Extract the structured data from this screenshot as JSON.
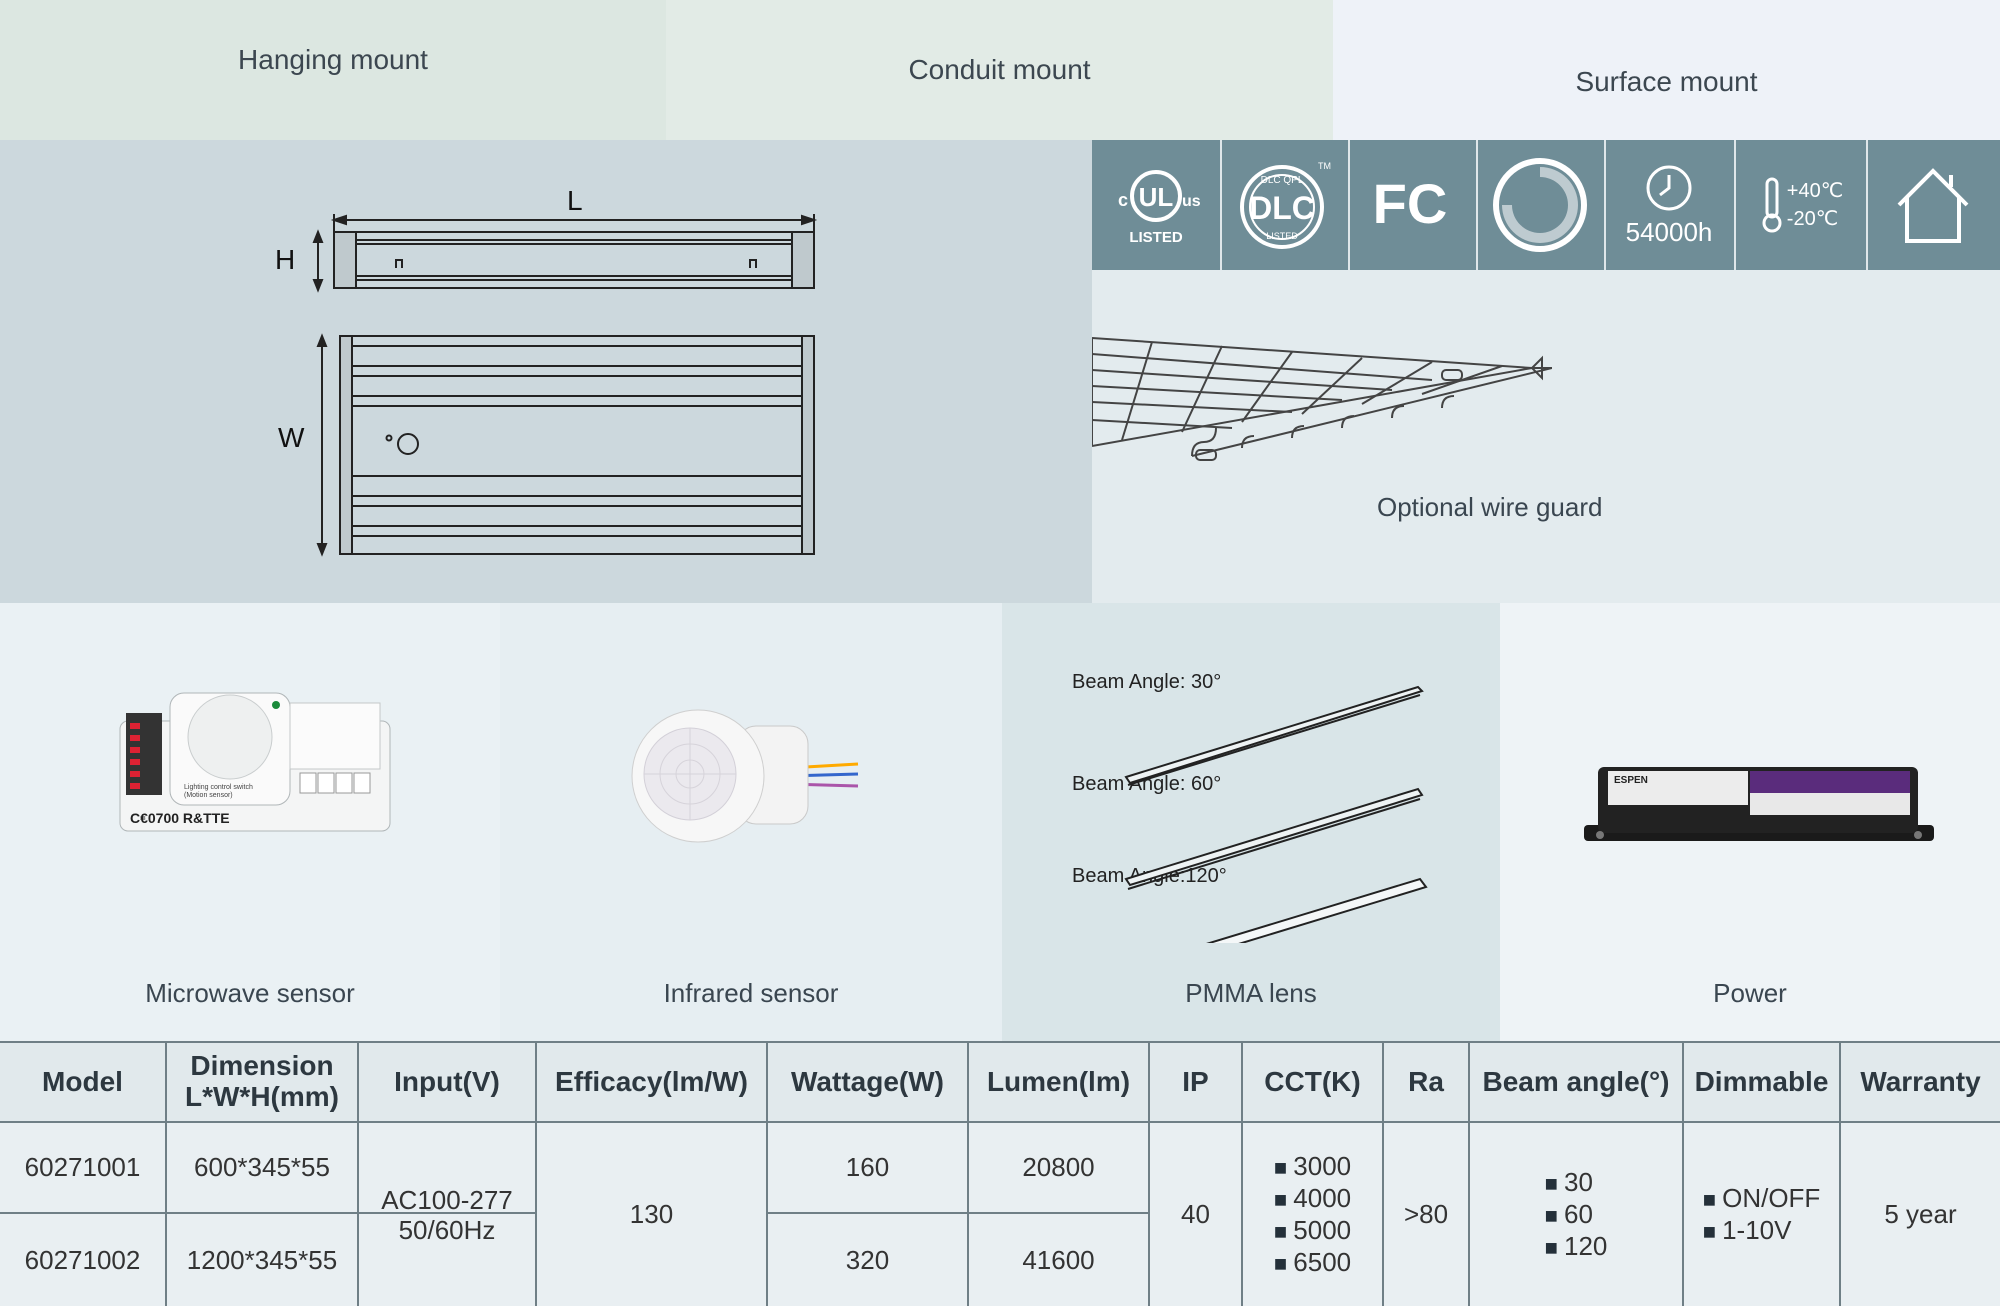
{
  "mounts": [
    "Hanging mount",
    "Conduit mount",
    "Surface mount"
  ],
  "dimensions": {
    "l": "L",
    "h": "H",
    "w": "W"
  },
  "certifications": {
    "ul": {
      "c": "c",
      "ul": "UL",
      "us": "us",
      "listed": "LISTED",
      "icon": "ul-listed-icon"
    },
    "dlc": {
      "top": "DLC QPL",
      "main": "DLC",
      "tm": "TM",
      "bottom": "LISTED",
      "icon": "dlc-qpl-icon"
    },
    "fcc": {
      "label": "FC",
      "icon": "fcc-icon"
    },
    "dimming": {
      "icon": "dimming-icon"
    },
    "lifetime": {
      "value": "54000h",
      "icon": "clock-icon"
    },
    "temperature": {
      "high": "+40℃",
      "low": "-20℃",
      "icon": "thermometer-icon"
    },
    "indoor": {
      "icon": "house-icon"
    }
  },
  "wire_guard": {
    "label": "Optional wire guard"
  },
  "accessories": [
    "Microwave sensor",
    "Infrared sensor",
    "PMMA lens",
    "Power"
  ],
  "microwave_sensor_print": {
    "line1": "Lighting control switch",
    "line2": "(Motion sensor)",
    "marks": "C€0700 R&TTE"
  },
  "power_print": {
    "brand": "ESPEN"
  },
  "beam_angles": [
    "Beam Angle: 30°",
    "Beam Angle: 60°",
    "Beam Angle:120°"
  ],
  "table": {
    "headers": {
      "model": "Model",
      "dimension1": "Dimension",
      "dimension2": "L*W*H(mm)",
      "input": "Input(V)",
      "efficacy": "Efficacy(lm/W)",
      "wattage": "Wattage(W)",
      "lumen": "Lumen(lm)",
      "ip": "IP",
      "cct": "CCT(K)",
      "ra": "Ra",
      "beam": "Beam angle(°)",
      "dimmable": "Dimmable",
      "warranty": "Warranty"
    },
    "rows": [
      {
        "model": "60271001",
        "dimension": "600*345*55",
        "wattage": "160",
        "lumen": "20800"
      },
      {
        "model": "60271002",
        "dimension": "1200*345*55",
        "wattage": "320",
        "lumen": "41600"
      }
    ],
    "shared": {
      "input1": "AC100-277",
      "input2": "50/60Hz",
      "efficacy": "130",
      "ip": "40",
      "cct": [
        "3000",
        "4000",
        "5000",
        "6500"
      ],
      "ra": ">80",
      "beam": [
        "30",
        "60",
        "120"
      ],
      "dimmable": [
        "ON/OFF",
        "1-10V"
      ],
      "warranty": "5 year"
    }
  },
  "colors": {
    "cert_bar": "#6f8d97",
    "dim_panel": "#ccd8dd",
    "table_line": "#6f7f86"
  }
}
